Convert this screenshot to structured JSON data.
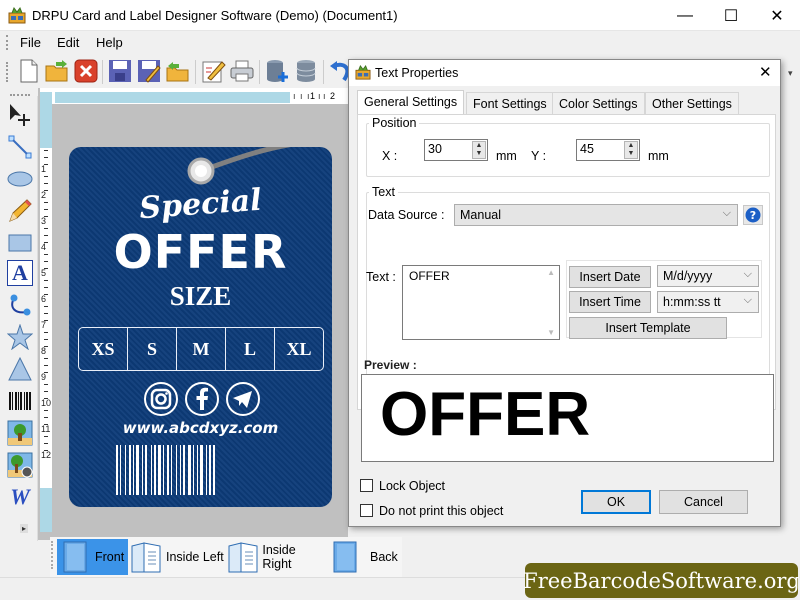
{
  "window": {
    "title": "DRPU Card and Label Designer Software (Demo) (Document1)",
    "minimize_glyph": "—",
    "maximize_glyph": "☐",
    "close_glyph": "✕"
  },
  "menu": {
    "items": [
      {
        "label": "File"
      },
      {
        "label": "Edit"
      },
      {
        "label": "Help"
      }
    ]
  },
  "toolbar": {
    "icons": [
      "new-document-icon",
      "open-folder-icon",
      "close-document-icon",
      "save-icon",
      "save-as-icon",
      "export-icon",
      "edit-icon",
      "print-icon",
      "database-add-icon",
      "database-icon",
      "undo-icon"
    ]
  },
  "left_tools": [
    "pointer-move-icon",
    "line-icon",
    "ellipse-icon",
    "pencil-icon",
    "rectangle-icon",
    "text-icon",
    "arc-icon",
    "star-icon",
    "triangle-icon",
    "barcode-icon",
    "picture-icon",
    "picture-library-icon",
    "word-art-icon"
  ],
  "ruler": {
    "horizontal_ticks": [
      "1",
      "2"
    ],
    "vertical_ticks": [
      "1",
      "2",
      "3",
      "4",
      "5",
      "6",
      "7",
      "8",
      "9",
      "10",
      "11",
      "12"
    ]
  },
  "tag": {
    "script_title": "Special",
    "headline": "OFFER",
    "subheadline": "SIZE",
    "sizes": [
      "XS",
      "S",
      "M",
      "L",
      "XL"
    ],
    "social_icons": [
      "instagram-icon",
      "facebook-icon",
      "telegram-icon"
    ],
    "website": "www.abcdxyz.com",
    "bg_color": "#0d3b79"
  },
  "dialog": {
    "title": "Text Properties",
    "close_glyph": "✕",
    "tabs": [
      {
        "label": "General Settings",
        "active": true
      },
      {
        "label": "Font Settings",
        "active": false
      },
      {
        "label": "Color Settings",
        "active": false
      },
      {
        "label": "Other Settings",
        "active": false
      }
    ],
    "position": {
      "group_label": "Position",
      "x_label": "X :",
      "x_value": "30",
      "x_unit": "mm",
      "y_label": "Y :",
      "y_value": "45",
      "y_unit": "mm"
    },
    "text_group": {
      "group_label": "Text",
      "data_source_label": "Data Source :",
      "data_source_value": "Manual",
      "text_label": "Text :",
      "text_value": "OFFER",
      "insert_date_label": "Insert Date",
      "date_format": "M/d/yyyy",
      "insert_time_label": "Insert Time",
      "time_format": "h:mm:ss tt",
      "insert_template_label": "Insert Template"
    },
    "preview": {
      "label": "Preview :",
      "text": "OFFER"
    },
    "lock_object_label": "Lock Object",
    "lock_object_checked": false,
    "do_not_print_label": "Do not print this object",
    "do_not_print_checked": false,
    "ok_label": "OK",
    "cancel_label": "Cancel"
  },
  "pages": [
    {
      "label": "Front",
      "active": true
    },
    {
      "label": "Inside Left",
      "active": false
    },
    {
      "label": "Inside Right",
      "active": false
    },
    {
      "label": "Back",
      "active": false
    }
  ],
  "watermark": "FreeBarcodeSoftware.org"
}
